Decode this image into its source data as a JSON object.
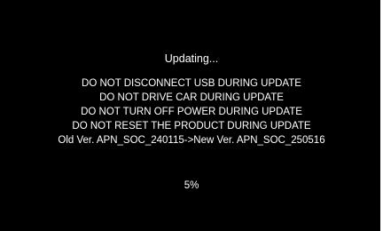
{
  "screen": {
    "title": "Updating...",
    "warnings": [
      "DO NOT DISCONNECT USB DURING UPDATE",
      "DO NOT DRIVE CAR DURING UPDATE",
      "DO NOT TURN OFF POWER DURING UPDATE",
      "DO NOT RESET THE PRODUCT DURING UPDATE"
    ],
    "version_text": "Old Ver. APN_SOC_240115->New Ver. APN_SOC_250516",
    "progress_text": "5%",
    "colors": {
      "background": "#000000",
      "text": "#ffffff"
    }
  }
}
